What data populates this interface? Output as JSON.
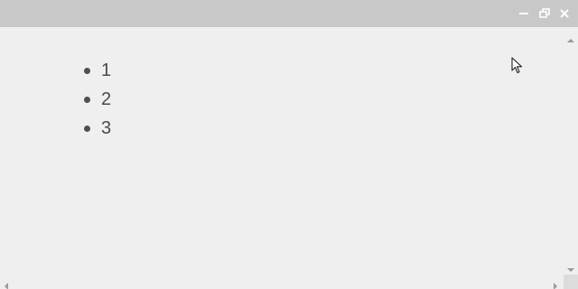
{
  "window": {
    "controls": {
      "minimize_icon": "minimize-icon",
      "restore_icon": "restore-icon",
      "close_icon": "close-icon"
    }
  },
  "list": {
    "items": [
      "1",
      "2",
      "3"
    ]
  },
  "colors": {
    "titlebar": "#c8c8c8",
    "background": "#efefef",
    "text": "#4a4a4a"
  }
}
